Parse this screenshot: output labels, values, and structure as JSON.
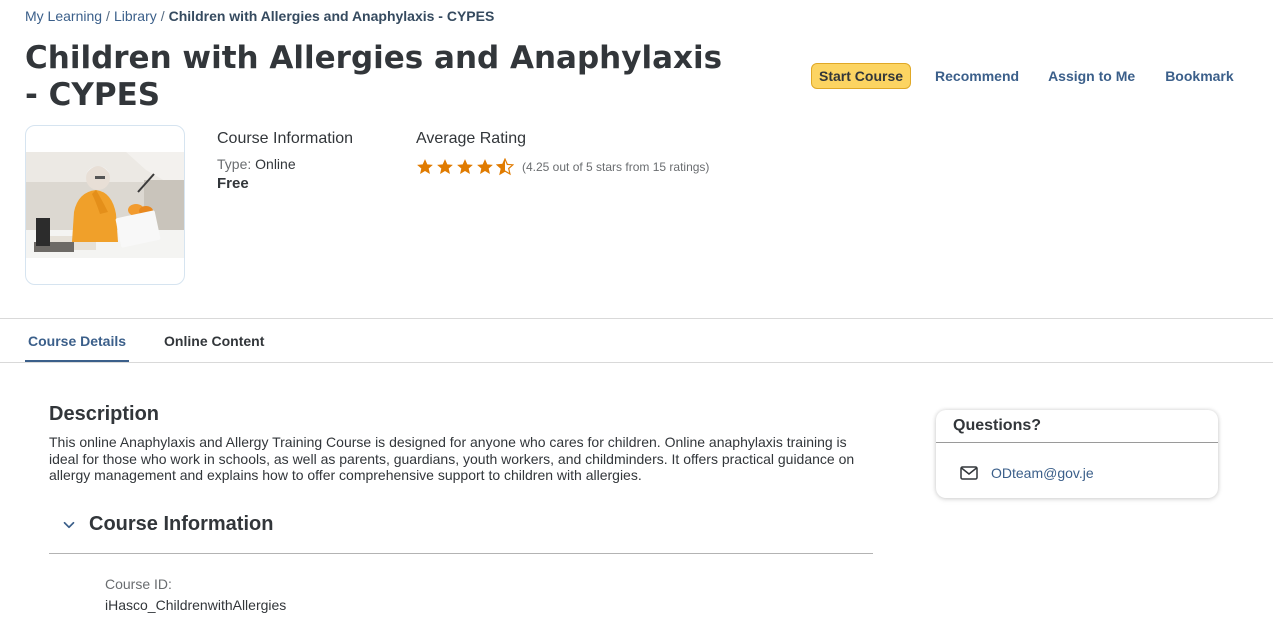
{
  "breadcrumb": {
    "items": [
      "My Learning",
      "Library"
    ],
    "separator": "/",
    "current": "Children with Allergies and Anaphylaxis - CYPES"
  },
  "page_title": "Children with Allergies and Anaphylaxis - CYPES",
  "actions": {
    "start_course": "Start Course",
    "recommend": "Recommend",
    "assign_to_me": "Assign to Me",
    "bookmark": "Bookmark"
  },
  "course_info": {
    "heading": "Course Information",
    "type_label": "Type:",
    "type_value": "Online",
    "price": "Free"
  },
  "rating": {
    "heading": "Average Rating",
    "value": 4.25,
    "max": 5,
    "text": "(4.25 out of 5 stars from 15 ratings)"
  },
  "tabs": [
    {
      "label": "Course Details",
      "active": true
    },
    {
      "label": "Online Content",
      "active": false
    }
  ],
  "description": {
    "title": "Description",
    "text": "This online Anaphylaxis and Allergy Training Course is designed for anyone who cares for children. Online anaphylaxis training is ideal for those who work in schools, as well as parents, guardians, youth workers, and childminders. It offers practical guidance on allergy management and explains how to offer comprehensive support to children with allergies."
  },
  "course_information_section": {
    "title": "Course Information",
    "expanded": true,
    "course_id_label": "Course ID:",
    "course_id_value": "iHasco_ChildrenwithAllergies"
  },
  "questions": {
    "title": "Questions?",
    "email": "ODteam@gov.je",
    "icon": "mail-icon"
  },
  "colors": {
    "accent": "#3b5f8a",
    "primary_button": "#fcd462",
    "star": "#e07b00"
  }
}
